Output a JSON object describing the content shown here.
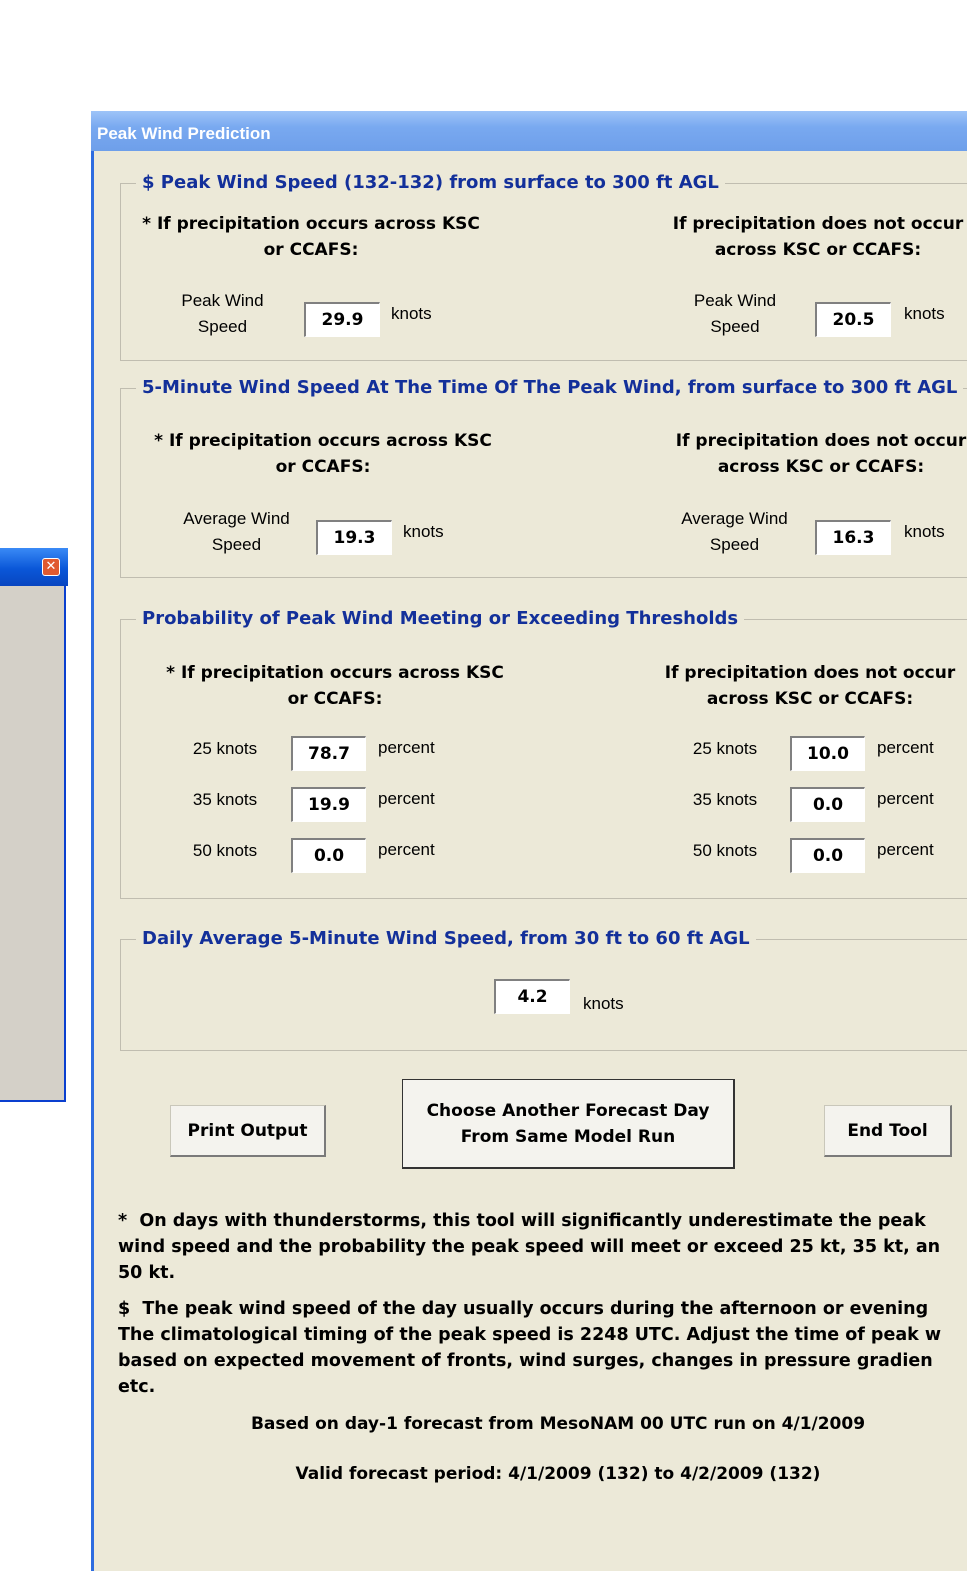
{
  "window": {
    "title": "Peak Wind Prediction"
  },
  "peak": {
    "legend": "$ Peak Wind Speed (132-132) from surface to 300 ft AGL",
    "precip_heading": "* If precipitation occurs across KSC\nor CCAFS:",
    "noprecip_heading": "If precipitation does not occur\nacross KSC or CCAFS:",
    "label": "Peak Wind\nSpeed",
    "precip_value": "29.9",
    "noprecip_value": "20.5",
    "unit": "knots"
  },
  "fivemin": {
    "legend": "5-Minute Wind Speed At The Time Of The Peak Wind, from surface to 300 ft AGL",
    "precip_heading": "* If precipitation occurs across KSC\nor CCAFS:",
    "noprecip_heading": "If precipitation does not occur\nacross KSC or CCAFS:",
    "label": "Average Wind\nSpeed",
    "precip_value": "19.3",
    "noprecip_value": "16.3",
    "unit": "knots"
  },
  "prob": {
    "legend": "Probability of Peak Wind Meeting or Exceeding Thresholds",
    "precip_heading": "* If precipitation occurs across KSC\nor CCAFS:",
    "noprecip_heading": "If precipitation does not occur\nacross KSC or CCAFS:",
    "unit": "percent",
    "rows": [
      {
        "label": "25 knots",
        "precip": "78.7",
        "noprecip": "10.0"
      },
      {
        "label": "35 knots",
        "precip": "19.9",
        "noprecip": "0.0"
      },
      {
        "label": "50 knots",
        "precip": "0.0",
        "noprecip": "0.0"
      }
    ]
  },
  "daily": {
    "legend": "Daily Average 5-Minute Wind Speed, from 30 ft to 60 ft AGL",
    "value": "4.2",
    "unit": "knots"
  },
  "buttons": {
    "print": "Print Output",
    "choose": "Choose Another Forecast Day\nFrom Same Model Run",
    "end": "End Tool"
  },
  "notes": {
    "thunder": "*  On days with thunderstorms, this tool will significantly underestimate the peak\nwind speed and the probability the peak speed will meet or exceed 25 kt, 35 kt, an\n50 kt.",
    "timing": "$  The peak wind speed of the day usually occurs during the afternoon or evening\nThe climatological timing of the peak speed is 2248 UTC. Adjust the time of peak w\nbased on expected movement of fronts, wind surges, changes in pressure gradien\netc."
  },
  "footer": {
    "based_on": "Based on day-1 forecast from MesoNAM 00 UTC run on 4/1/2009",
    "valid": "Valid forecast period: 4/1/2009 (132) to 4/2/2009 (132)"
  },
  "background_dialog": {
    "close_glyph": "✕"
  },
  "colors": {
    "legend": "#13309a",
    "titlebar": "#79a9f0",
    "dialog_bg": "#ece9d8"
  }
}
